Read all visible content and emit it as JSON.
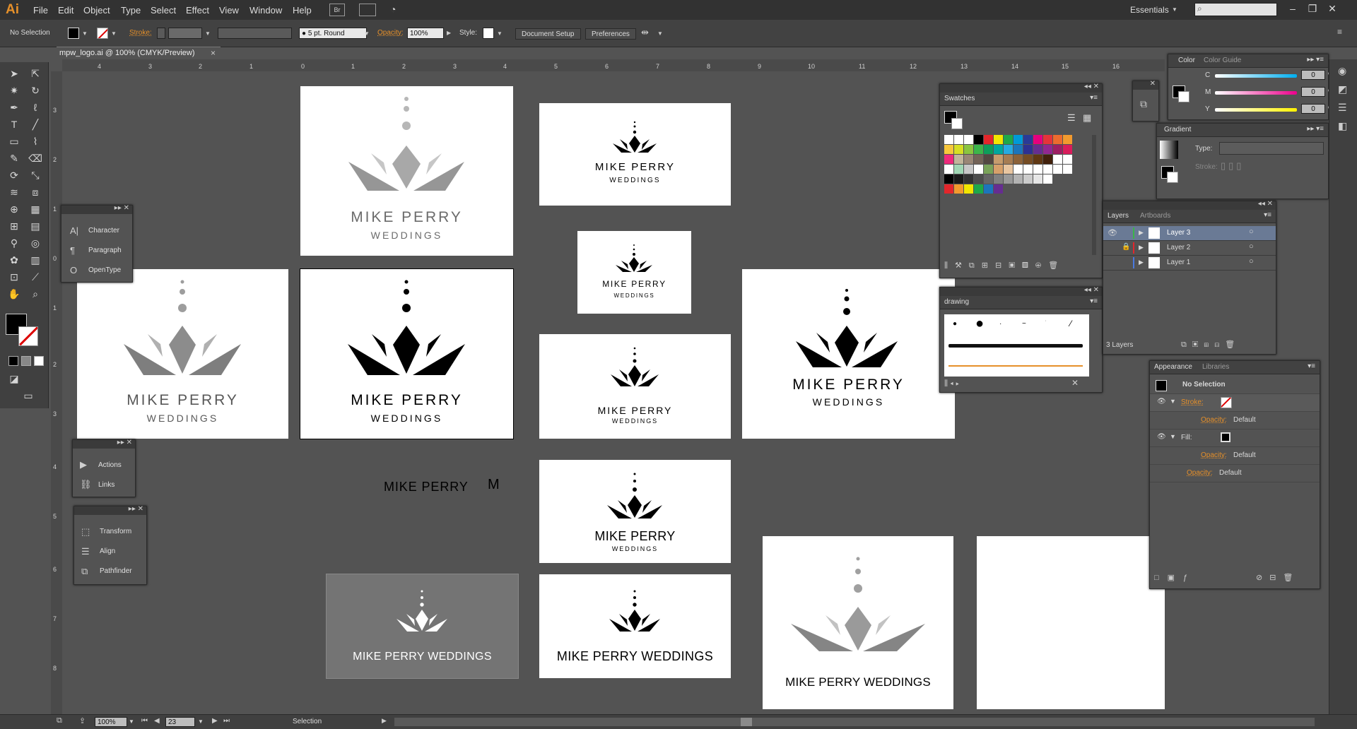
{
  "app": {
    "logo": "Ai",
    "menus": [
      "File",
      "Edit",
      "Object",
      "Type",
      "Select",
      "Effect",
      "View",
      "Window",
      "Help"
    ],
    "bridge_label": "Br",
    "workspace": "Essentials",
    "search_placeholder": ""
  },
  "control_bar": {
    "selection_label": "No Selection",
    "stroke_label": "Stroke:",
    "brush_label": "5 pt. Round",
    "opacity_label": "Opacity:",
    "opacity_value": "100%",
    "style_label": "Style:",
    "document_setup": "Document Setup",
    "preferences": "Preferences"
  },
  "document": {
    "tab_title": "mpw_logo.ai @ 100% (CMYK/Preview)",
    "close_glyph": "×"
  },
  "ruler": {
    "top_ticks": [
      "4",
      "3",
      "2",
      "1",
      "0",
      "1",
      "2",
      "3",
      "4",
      "5",
      "6",
      "7",
      "8",
      "9",
      "10",
      "11",
      "12",
      "13",
      "14",
      "15",
      "16"
    ],
    "left_ticks": [
      "3",
      "2",
      "1",
      "0",
      "1",
      "2",
      "3",
      "4",
      "5",
      "6",
      "7",
      "8"
    ]
  },
  "panels": {
    "type_panel": [
      "Character",
      "Paragraph",
      "OpenType"
    ],
    "actions_panel": [
      "Actions",
      "Links"
    ],
    "transform_panel": [
      "Transform",
      "Align",
      "Pathfinder"
    ],
    "swatches": {
      "title": "Swatches",
      "colors": [
        [
          "#ffffff",
          "#ffffff",
          "#ffffff",
          "#000000",
          "#e3262b",
          "#f2e600",
          "#1ea84a",
          "#0099d8",
          "#2a3a96",
          "#e5007e",
          "#e5343a",
          "#ed6b2e",
          "#f39a2e"
        ],
        [
          "#f7c73b",
          "#d7df23",
          "#8bc53f",
          "#3cb54a",
          "#0d9d5a",
          "#00a79d",
          "#27aae1",
          "#1c75bc",
          "#2e3192",
          "#662d91",
          "#92278f",
          "#9e1f63",
          "#d91c5c"
        ],
        [
          "#ee2a7b",
          "#c2b59b",
          "#998675",
          "#736357",
          "#534741",
          "#c69c6d",
          "#a67c52",
          "#8c6239",
          "#754c24",
          "#603813",
          "#42210b",
          "#ffffff",
          "#ffffff"
        ],
        [
          "#ffffff",
          "#a0d6b4",
          "#c8c8c8",
          "#ffffff",
          "#7aa35a",
          "#d6a06a",
          "#e8c5a0",
          "#ffffff",
          "#ffffff",
          "#ffffff",
          "#ffffff",
          "#ffffff",
          "#ffffff"
        ],
        [
          "#000000",
          "#1a1a1a",
          "#333333",
          "#4d4d4d",
          "#666666",
          "#808080",
          "#999999",
          "#b3b3b3",
          "#cccccc",
          "#e6e6e6",
          "#ffffff",
          "#535353",
          "#535353"
        ],
        [
          "#e3262b",
          "#f39a2e",
          "#f2e600",
          "#1ea84a",
          "#1c75bc",
          "#662d91",
          "#535353",
          "#535353",
          "#535353",
          "#535353",
          "#535353",
          "#535353",
          "#535353"
        ]
      ]
    },
    "drawing": {
      "title": "drawing"
    },
    "color": {
      "tabs": [
        "Color",
        "Color Guide"
      ],
      "channels": [
        {
          "label": "C",
          "value": "0",
          "unit": "%",
          "gradient": "#00aeef"
        },
        {
          "label": "M",
          "value": "0",
          "unit": "%",
          "gradient": "#ec008c"
        },
        {
          "label": "Y",
          "value": "0",
          "unit": "%",
          "gradient": "#fff200"
        }
      ]
    },
    "gradient": {
      "title": "Gradient",
      "type_label": "Type:",
      "stroke_label": "Stroke:"
    },
    "layers": {
      "tabs": [
        "Layers",
        "Artboards"
      ],
      "rows": [
        {
          "name": "Layer 3",
          "color": "#3cb54a"
        },
        {
          "name": "Layer 2",
          "color": "#e3262b"
        },
        {
          "name": "Layer 1",
          "color": "#4a7adf"
        }
      ],
      "count": "3 Layers"
    },
    "appearance": {
      "tabs": [
        "Appearance",
        "Libraries"
      ],
      "header": "No Selection",
      "stroke": "Stroke:",
      "opacity": "Opacity:",
      "default": "Default",
      "fill": "Fill:"
    }
  },
  "artboards": {
    "brand_title": "MIKE PERRY",
    "brand_sub": "WEDDINGS",
    "brand_inline": "MIKE PERRY WEDDINGS",
    "wordmark_m": "M"
  },
  "status_bar": {
    "zoom": "100%",
    "artboard_number": "23",
    "tool": "Selection"
  },
  "colors": {
    "accent": "#e6902a",
    "logo_gray_light": "#b7b7b7",
    "logo_gray_dark": "#8c8c8c",
    "logo_black": "#000000"
  }
}
